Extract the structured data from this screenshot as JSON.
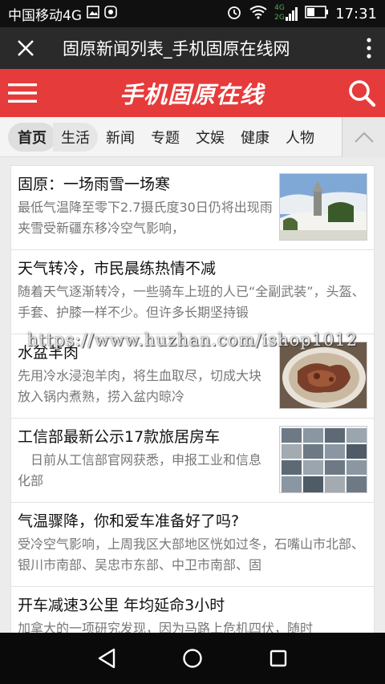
{
  "status": {
    "carrier": "中国移动4G",
    "signal_tag": "4G",
    "signal_tag2": "2G",
    "time": "17:31"
  },
  "browser": {
    "title": "固原新闻列表_手机固原在线网"
  },
  "site": {
    "logo": "手机固原在线",
    "brand_color": "#e63b3b"
  },
  "categories": [
    {
      "label": "首页"
    },
    {
      "label": "生活"
    },
    {
      "label": "新闻"
    },
    {
      "label": "专题"
    },
    {
      "label": "文娱"
    },
    {
      "label": "健康"
    },
    {
      "label": "人物"
    }
  ],
  "articles": [
    {
      "title": "固原：一场雨雪一场寒",
      "desc": "最低气温降至零下2.7摄氏度30日仍将出现雨夹雪受新疆东移冷空气影响，",
      "thumb": "monument-snow-photo"
    },
    {
      "title": "天气转冷，市民晨练热情不减",
      "desc": "随着天气逐渐转冷，一些骑车上班的人已“全副武装”，头盔、手套、护膝一样不少。但许多长期坚持锻",
      "thumb": ""
    },
    {
      "title": "水盆羊肉",
      "desc": "先用冷水浸泡羊肉，将生血取尽，切成大块放入锅内煮熟，捞入盆内晾冷",
      "thumb": "mutton-dish-photo"
    },
    {
      "title": "工信部最新公示17款旅居房车",
      "desc": "　日前从工信部官网获悉，申报工业和信息化部",
      "thumb": "rv-collage-photo"
    },
    {
      "title": "气温骤降，你和爱车准备好了吗?",
      "desc": "受冷空气影响，上周我区大部地区恍如过冬，石嘴山市北部、银川市南部、吴忠市东部、中卫市南部、固",
      "thumb": ""
    },
    {
      "title": "开车减速3公里 年均延命3小时",
      "desc": "加拿大的一项研究发现，因为马路上危机四伏，随时",
      "thumb": ""
    }
  ],
  "watermark": "https://www.huzhan.com/ishop1012"
}
